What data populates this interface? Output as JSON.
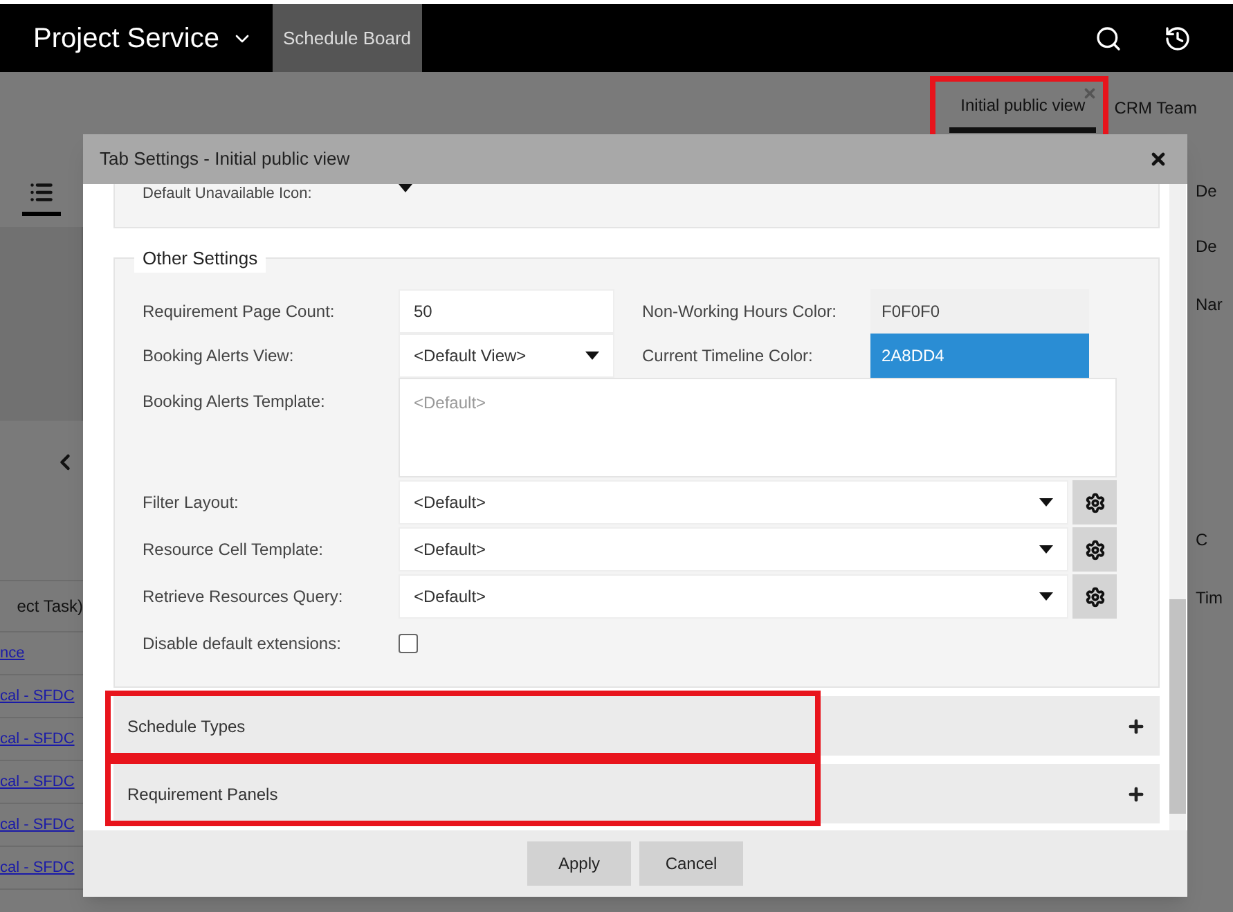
{
  "app_bar": {
    "title": "Project Service",
    "nav_item": "Schedule Board"
  },
  "view_tabs": [
    {
      "label": "Initial public view",
      "selected": true,
      "highlighted": true
    },
    {
      "label": "CRM Team",
      "selected": false,
      "highlighted": false
    }
  ],
  "background_left": {
    "header": "ect Task)",
    "links": [
      "nce",
      "cal - SFDC",
      "cal - SFDC",
      "cal - SFDC",
      "cal - SFDC",
      "cal - SFDC"
    ]
  },
  "background_right": {
    "labels": [
      "De",
      "De",
      "Nar",
      "C",
      "Tim"
    ]
  },
  "dialog": {
    "title": "Tab Settings - Initial public view",
    "partial_field": {
      "label": "Default Unavailable Icon:"
    },
    "section": {
      "legend": "Other Settings",
      "rows": [
        {
          "kind": "pair",
          "label": "Requirement Page Count:",
          "value": "50",
          "label_2": "Non-Working Hours Color:",
          "value_2": "F0F0F0"
        },
        {
          "kind": "select_pair",
          "label": "Booking Alerts View:",
          "value": "<Default View>",
          "label_2": "Current Timeline Color:",
          "value_2": "2A8DD4"
        },
        {
          "kind": "textarea",
          "label": "Booking Alerts Template:",
          "placeholder": "<Default>"
        },
        {
          "kind": "select_gear",
          "label": "Filter Layout:",
          "value": "<Default>"
        },
        {
          "kind": "select_gear",
          "label": "Resource Cell Template:",
          "value": "<Default>"
        },
        {
          "kind": "select_gear",
          "label": "Retrieve Resources Query:",
          "value": "<Default>"
        },
        {
          "kind": "checkbox",
          "label": "Disable default extensions:",
          "checked": false
        }
      ]
    },
    "accordions": [
      {
        "label": "Schedule Types",
        "expanded": false,
        "highlighted": true
      },
      {
        "label": "Requirement Panels",
        "expanded": false,
        "highlighted": true
      }
    ],
    "buttons": [
      "Apply",
      "Cancel"
    ]
  }
}
